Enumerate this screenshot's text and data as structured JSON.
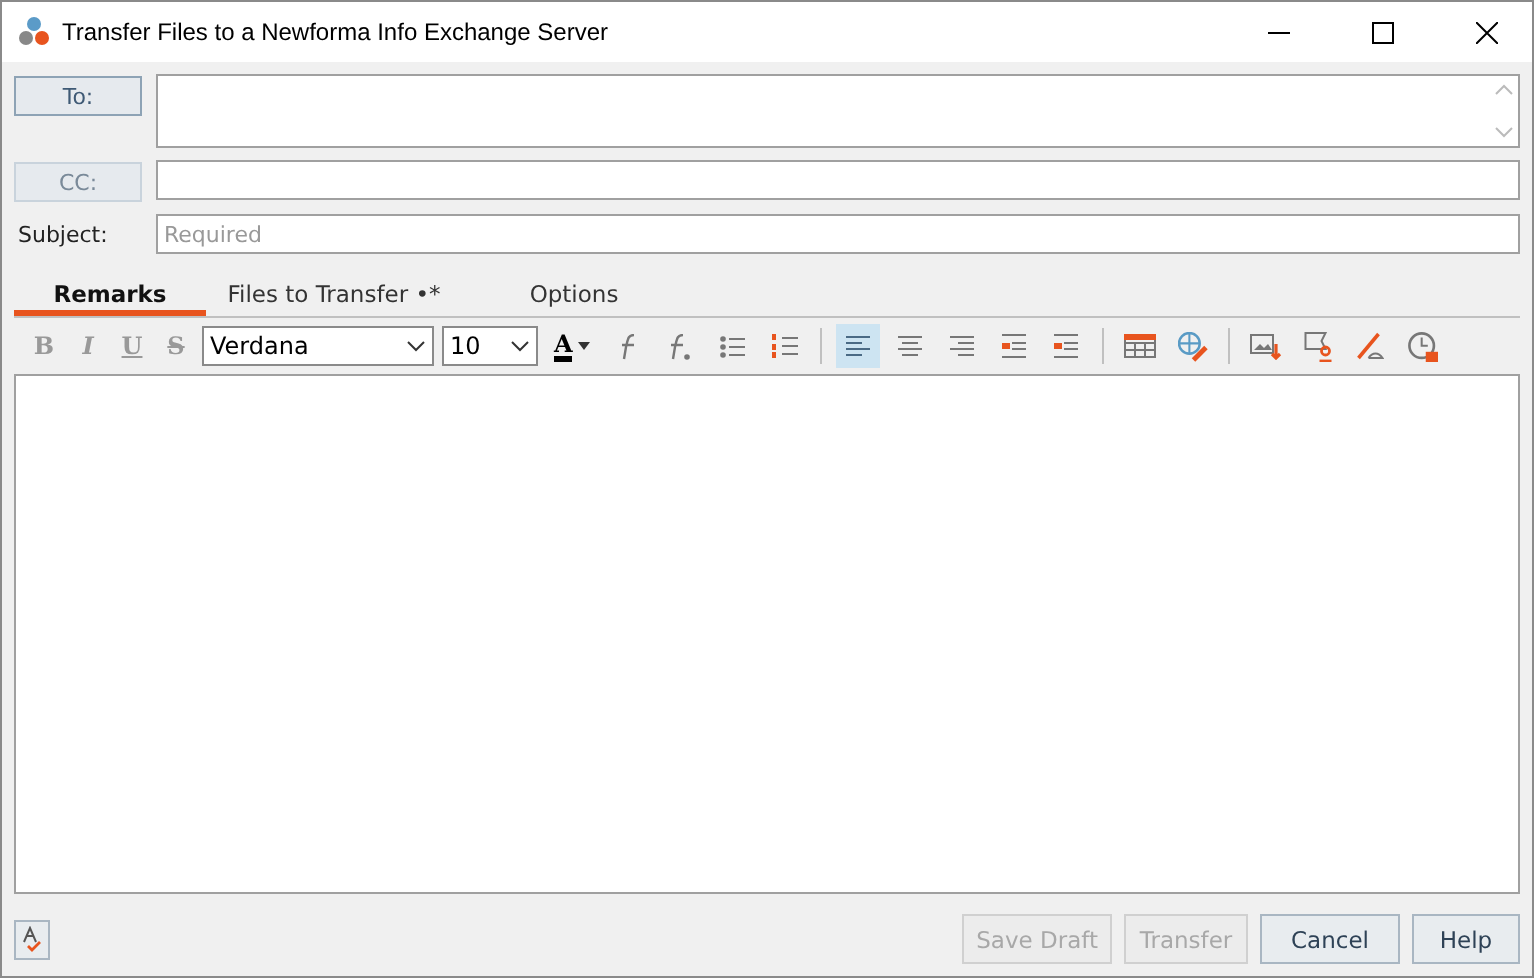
{
  "window": {
    "title": "Transfer Files to a Newforma Info Exchange Server"
  },
  "fields": [
    {
      "kind": "button",
      "label": "To:",
      "disabled": false
    },
    {
      "kind": "button",
      "label": "CC:",
      "disabled": true
    },
    {
      "kind": "text",
      "label": "Subject:",
      "placeholder": "Required"
    }
  ],
  "tabs": [
    {
      "label": "Remarks",
      "selected": true
    },
    {
      "label": "Files to Transfer •*",
      "selected": false
    },
    {
      "label": "Options",
      "selected": false
    }
  ],
  "toolbar": [
    {
      "kind": "letter",
      "label": "B"
    },
    {
      "kind": "letter",
      "label": "I"
    },
    {
      "kind": "letter",
      "label": "U"
    },
    {
      "kind": "letter",
      "label": "S"
    },
    {
      "kind": "select",
      "value": "Verdana"
    },
    {
      "kind": "select",
      "value": "10"
    },
    {
      "kind": "color",
      "label": "A"
    },
    {
      "kind": "icon",
      "selected": false
    },
    {
      "kind": "icon",
      "selected": false
    },
    {
      "kind": "icon",
      "selected": false
    },
    {
      "kind": "icon",
      "selected": false
    },
    {
      "kind": "sep"
    },
    {
      "kind": "icon",
      "selected": true
    },
    {
      "kind": "icon",
      "selected": false
    },
    {
      "kind": "icon",
      "selected": false
    },
    {
      "kind": "icon",
      "selected": false
    },
    {
      "kind": "icon",
      "selected": false
    },
    {
      "kind": "sep"
    },
    {
      "kind": "icon",
      "selected": false
    },
    {
      "kind": "icon",
      "selected": false
    },
    {
      "kind": "sep"
    },
    {
      "kind": "icon",
      "selected": false
    },
    {
      "kind": "icon",
      "selected": false
    },
    {
      "kind": "icon",
      "selected": false
    },
    {
      "kind": "icon",
      "selected": false
    }
  ],
  "buttons": [
    {
      "label": "Save Draft",
      "disabled": true
    },
    {
      "label": "Transfer",
      "disabled": true
    },
    {
      "label": "Cancel",
      "disabled": false
    },
    {
      "label": "Help",
      "disabled": false
    }
  ]
}
